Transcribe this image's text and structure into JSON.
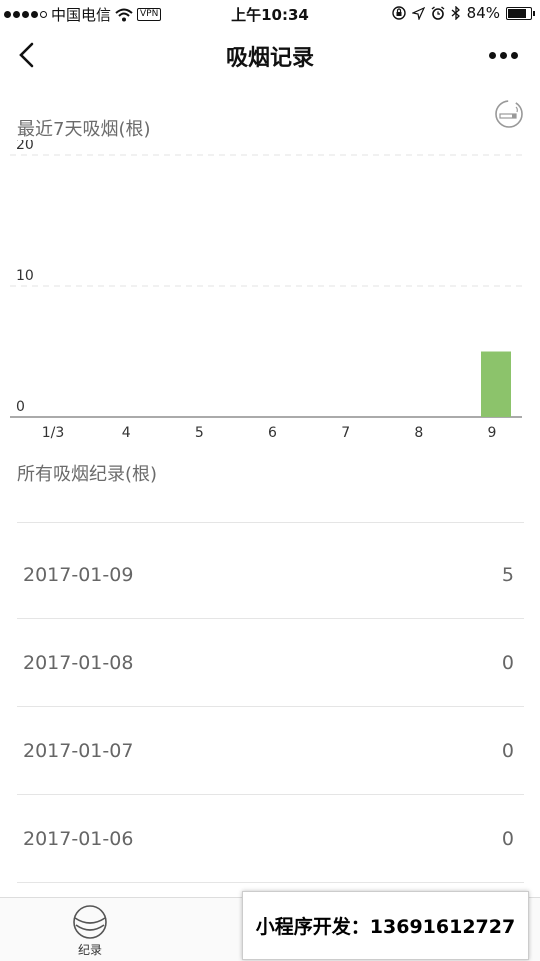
{
  "status_bar": {
    "carrier": "中国电信",
    "vpn": "VPN",
    "time": "上午10:34",
    "battery": "84%",
    "battery_level": 0.84
  },
  "nav": {
    "title": "吸烟记录"
  },
  "chart_section": {
    "title": "最近7天吸烟(根)"
  },
  "chart_data": {
    "type": "bar",
    "categories": [
      "1/3",
      "4",
      "5",
      "6",
      "7",
      "8",
      "9"
    ],
    "values": [
      0,
      0,
      0,
      0,
      0,
      0,
      5
    ],
    "yticks": [
      "0",
      "10",
      "20"
    ],
    "ylim": [
      0,
      20
    ],
    "bar_color": "#8cc36b",
    "grid": "dashed-horizontal"
  },
  "records_section": {
    "title": "所有吸烟纪录(根)"
  },
  "records": [
    {
      "date": "2017-01-09",
      "count": "5"
    },
    {
      "date": "2017-01-08",
      "count": "0"
    },
    {
      "date": "2017-01-07",
      "count": "0"
    },
    {
      "date": "2017-01-06",
      "count": "0"
    }
  ],
  "tab_bar": {
    "items": [
      {
        "label": "纪录",
        "icon": "record-icon"
      }
    ]
  },
  "watermark": {
    "text": "小程序开发：13691612727"
  }
}
